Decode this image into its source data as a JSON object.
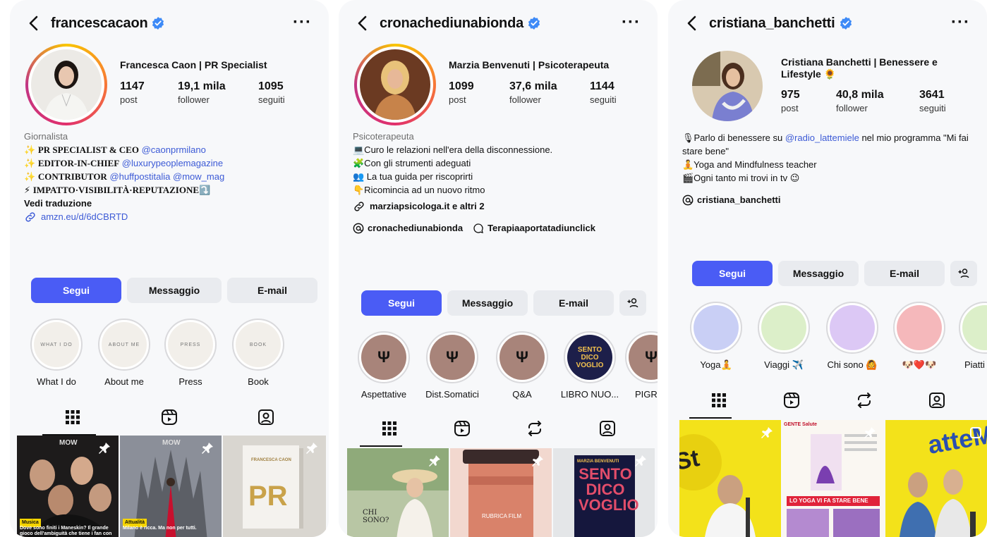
{
  "colors": {
    "accent": "#4a5cf5",
    "verified": "#3d8af7",
    "link": "#3c5ad6"
  },
  "profiles": [
    {
      "username": "francescacaon",
      "display_name": "Francesca Caon | PR Specialist",
      "stats": [
        {
          "n": "1147",
          "l": "post"
        },
        {
          "n": "19,1 mila",
          "l": "follower"
        },
        {
          "n": "1095",
          "l": "seguiti"
        }
      ],
      "category": "Giornalista",
      "bio": [
        {
          "pre": "✨ ",
          "b": "PR SPECIALIST & CEO",
          "tag": " @caonprmilano"
        },
        {
          "pre": "✨ ",
          "b": "EDITOR-IN-CHIEF",
          "tag": " @luxurypeoplemagazine"
        },
        {
          "pre": "✨ ",
          "b": "CONTRIBUTOR",
          "tag": " @huffpostitalia @mow_mag"
        },
        {
          "pre": "⚡ ",
          "b": "IMPATTO·VISIBILITÀ·REPUTAZIONE",
          "tag": "⤵️"
        }
      ],
      "translate": "Vedi traduzione",
      "link": "amzn.eu/d/6dCBRTD",
      "buttons": [
        "Segui",
        "Messaggio",
        "E-mail"
      ],
      "highlights": [
        {
          "label": "What I do",
          "inner": "WHAT I DO"
        },
        {
          "label": "About me",
          "inner": "ABOUT ME"
        },
        {
          "label": "Press",
          "inner": "PRESS"
        },
        {
          "label": "Book",
          "inner": "BOOK"
        }
      ],
      "posts": [
        {
          "top": "MOW",
          "tag": "Musica",
          "caption": "Dove sono finiti i Maneskin? Il grande gioco dell'ambiguità che tiene i fan con"
        },
        {
          "top": "MOW",
          "tag": "Attualità",
          "caption": "Milano è ricca. Ma non per tutti."
        },
        {
          "top": "FRANCESCA CAON",
          "big": "PR"
        }
      ]
    },
    {
      "username": "cronachediunabionda",
      "display_name": "Marzia Benvenuti | Psicoterapeuta",
      "stats": [
        {
          "n": "1099",
          "l": "post"
        },
        {
          "n": "37,6 mila",
          "l": "follower"
        },
        {
          "n": "1144",
          "l": "seguiti"
        }
      ],
      "category": "Psicoterapeuta",
      "bio": [
        "💻Curo le relazioni nell'era della disconnessione.",
        "🧩Con gli strumenti adeguati",
        "👥 La tua guida per riscoprirti",
        "👇Ricomincia ad un nuovo ritmo"
      ],
      "link": "marziapsicologa.it e altri 2",
      "threads": "cronachediunabionda",
      "threads2": "Terapiaaportatadiunclick",
      "buttons": [
        "Segui",
        "Messaggio",
        "E-mail"
      ],
      "highlights": [
        {
          "label": "Aspettative",
          "inner": "Ψ"
        },
        {
          "label": "Dist.Somatici",
          "inner": "Ψ"
        },
        {
          "label": "Q&A",
          "inner": "Ψ"
        },
        {
          "label": "LIBRO NUO...",
          "inner": "SENTO DICO VOGLIO"
        },
        {
          "label": "PIGR",
          "inner": "Ψ"
        }
      ],
      "posts": [
        {
          "big": "CHI SONO?"
        },
        {
          "big": "RUBRICA FILM"
        },
        {
          "top": "MARZIA BENVENUTI",
          "big": "SENTO DICO VOGLIO"
        }
      ]
    },
    {
      "username": "cristiana_banchetti",
      "display_name": "Cristiana Banchetti | Benessere e Lifestyle 🌻",
      "stats": [
        {
          "n": "975",
          "l": "post"
        },
        {
          "n": "40,8 mila",
          "l": "follower"
        },
        {
          "n": "3641",
          "l": "seguiti"
        }
      ],
      "bio_pre": "🎙Parlo di benessere su ",
      "bio_tag": "@radio_lattemiele",
      "bio_post": " nel mio programma \"Mi fai stare bene\"",
      "bio_lines": [
        "🧘Yoga and Mindfulness teacher",
        "🎬Ogni tanto mi trovi in tv 😉"
      ],
      "threads": "cristiana_banchetti",
      "buttons": [
        "Segui",
        "Messaggio",
        "E-mail"
      ],
      "highlights": [
        {
          "label": "Yoga🧘",
          "color": "#c9cff5"
        },
        {
          "label": "Viaggi ✈️",
          "color": "#dcefc9"
        },
        {
          "label": "Chi sono 🙆",
          "color": "#dcc8f5"
        },
        {
          "label": "🐶❤️🐶",
          "color": "#f5b8bb"
        },
        {
          "label": "Piatti",
          "color": "#dcefc9"
        }
      ],
      "posts": [
        {
          "big": "St"
        },
        {
          "top": "GENTE Salute",
          "big": "LO YOGA VI FA STARE BENE"
        },
        {
          "big": "atteM"
        }
      ]
    }
  ]
}
